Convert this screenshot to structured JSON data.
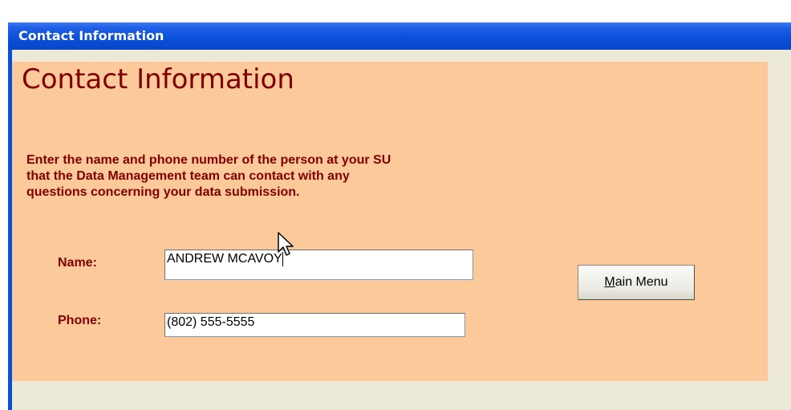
{
  "window": {
    "title": "Contact Information"
  },
  "form": {
    "heading": "Contact Information",
    "instructions": [
      "Enter the name and phone number of the person at your SU",
      "that the Data Management team can contact with any",
      "questions concerning your data submission."
    ],
    "fields": {
      "name": {
        "label": "Name:",
        "value": "ANDREW MCAVOY"
      },
      "phone": {
        "label": "Phone:",
        "value": "(802) 555-5555"
      }
    },
    "main_menu_button": {
      "mnemonic": "M",
      "rest": "ain Menu"
    }
  },
  "colors": {
    "titlebar": "#0a4fd8",
    "form_background": "#fcc99a",
    "label_text": "#800000",
    "client_background": "#ece9d8"
  },
  "icons": {
    "mouse_pointer": "arrow-cursor-icon"
  }
}
